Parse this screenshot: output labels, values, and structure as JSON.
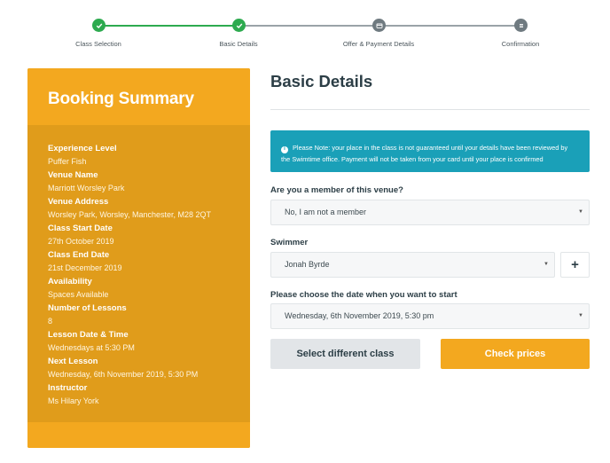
{
  "stepper": {
    "steps": [
      {
        "label": "Class Selection",
        "state": "done",
        "icon": "check-icon"
      },
      {
        "label": "Basic Details",
        "state": "done",
        "icon": "check-icon"
      },
      {
        "label": "Offer & Payment Details",
        "state": "todo",
        "icon": "card-icon"
      },
      {
        "label": "Confirmation",
        "state": "todo",
        "icon": "list-icon"
      }
    ]
  },
  "summary": {
    "title": "Booking Summary",
    "items": [
      {
        "label": "Experience Level",
        "value": "Puffer Fish"
      },
      {
        "label": "Venue Name",
        "value": "Marriott Worsley Park"
      },
      {
        "label": "Venue Address",
        "value": "Worsley Park, Worsley, Manchester, M28 2QT"
      },
      {
        "label": "Class Start Date",
        "value": "27th October 2019"
      },
      {
        "label": "Class End Date",
        "value": "21st December 2019"
      },
      {
        "label": "Availability",
        "value": "Spaces Available"
      },
      {
        "label": "Number of Lessons",
        "value": "8"
      },
      {
        "label": "Lesson Date & Time",
        "value": "Wednesdays at 5:30 PM"
      },
      {
        "label": "Next Lesson",
        "value": "Wednesday, 6th November 2019, 5:30 PM"
      },
      {
        "label": "Instructor",
        "value": "Ms Hilary York"
      }
    ]
  },
  "main": {
    "title": "Basic Details",
    "notice_line1": "Please Note: your place in the class is not guaranteed until your details have been reviewed by",
    "notice_line2": "the Swimtime office. Payment will not be taken from your card until your place is confirmed",
    "member": {
      "label": "Are you a member of this venue?",
      "value": "No, I am not a member"
    },
    "swimmer": {
      "label": "Swimmer",
      "value": "Jonah Byrde",
      "add_label": "+"
    },
    "start_date": {
      "label": "Please choose the date when you want to start",
      "value": "Wednesday, 6th November 2019, 5:30 pm"
    },
    "buttons": {
      "select_different": "Select different class",
      "check_prices": "Check prices"
    }
  },
  "colors": {
    "accent": "#f3a81f",
    "accent_dark": "#e09c1b",
    "success": "#2daa4f",
    "info": "#1aa0b8"
  }
}
